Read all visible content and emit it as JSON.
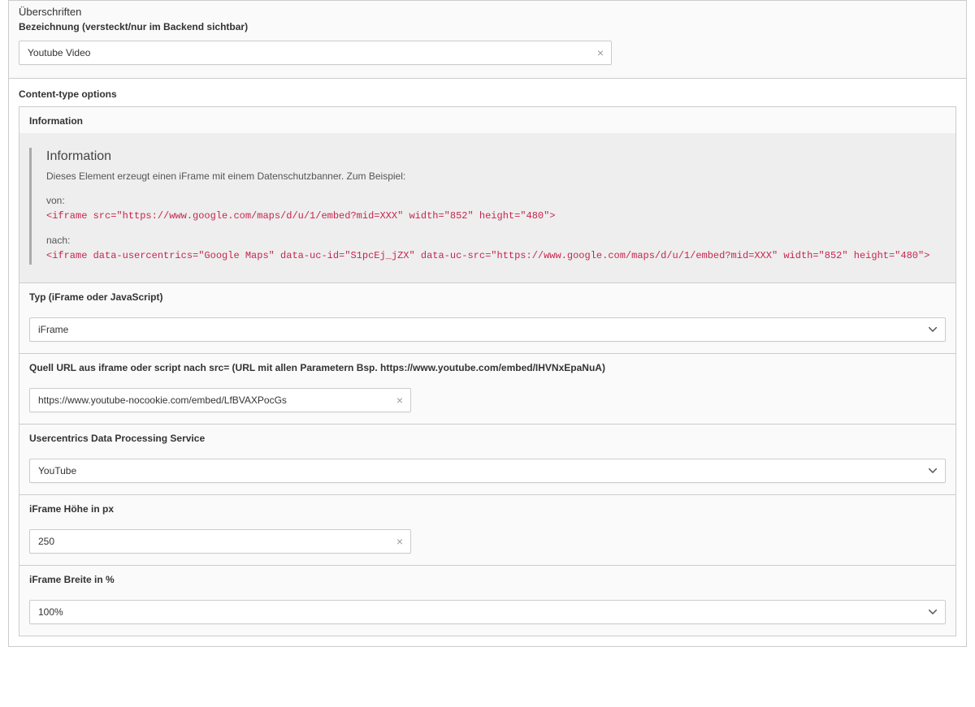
{
  "headings": {
    "section_title": "Überschriften",
    "label": "Bezeichnung (versteckt/nur im Backend sichtbar)",
    "value": "Youtube Video"
  },
  "content_options": {
    "title": "Content-type options",
    "information": {
      "label": "Information",
      "heading": "Information",
      "description": "Dieses Element erzeugt einen iFrame mit einem Datenschutzbanner. Zum Beispiel:",
      "from_label": "von:",
      "from_code": "<iframe src=\"https://www.google.com/maps/d/u/1/embed?mid=XXX\" width=\"852\" height=\"480\">",
      "to_label": "nach:",
      "to_code": "<iframe data-usercentrics=\"Google Maps\" data-uc-id=\"S1pcEj_jZX\" data-uc-src=\"https://www.google.com/maps/d/u/1/embed?mid=XXX\" width=\"852\" height=\"480\">"
    },
    "type": {
      "label": "Typ (iFrame oder JavaScript)",
      "value": "iFrame"
    },
    "source_url": {
      "label": "Quell URL aus iframe oder script nach src= (URL mit allen Parametern Bsp. https://www.youtube.com/embed/IHVNxEpaNuA)",
      "value": "https://www.youtube-nocookie.com/embed/LfBVAXPocGs"
    },
    "dps": {
      "label": "Usercentrics Data Processing Service",
      "value": "YouTube"
    },
    "height": {
      "label": "iFrame Höhe in px",
      "value": "250"
    },
    "width": {
      "label": "iFrame Breite in %",
      "value": "100%"
    }
  }
}
